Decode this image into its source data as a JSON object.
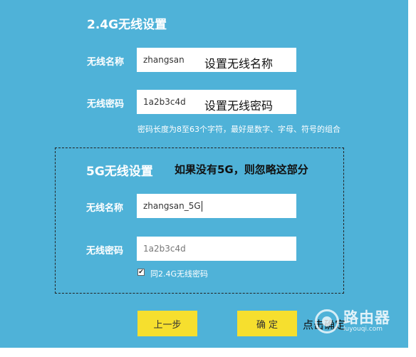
{
  "section_24g": {
    "title": "2.4G无线设置",
    "ssid_label": "无线名称",
    "ssid_value": "zhangsan",
    "ssid_annotation": "设置无线名称",
    "password_label": "无线密码",
    "password_value": "1a2b3c4d",
    "password_annotation": "设置无线密码",
    "password_hint": "密码长度为8至63个字符，最好是数字、字母、符号的组合"
  },
  "section_5g": {
    "title": "5G无线设置",
    "annotation": "如果没有5G，则忽略这部分",
    "ssid_label": "无线名称",
    "ssid_value": "zhangsan_5G",
    "password_label": "无线密码",
    "password_value": "1a2b3c4d",
    "same_password_checked": true,
    "same_password_label": "同2.4G无线密码"
  },
  "buttons": {
    "prev_label": "上一步",
    "confirm_label": "确 定"
  },
  "footer_annotation": "点击确定",
  "watermark": {
    "name": "路由器",
    "url": "luyouqi.com"
  },
  "colors": {
    "panel_bg": "#4fb2d8",
    "button_bg": "#f6df2e"
  }
}
